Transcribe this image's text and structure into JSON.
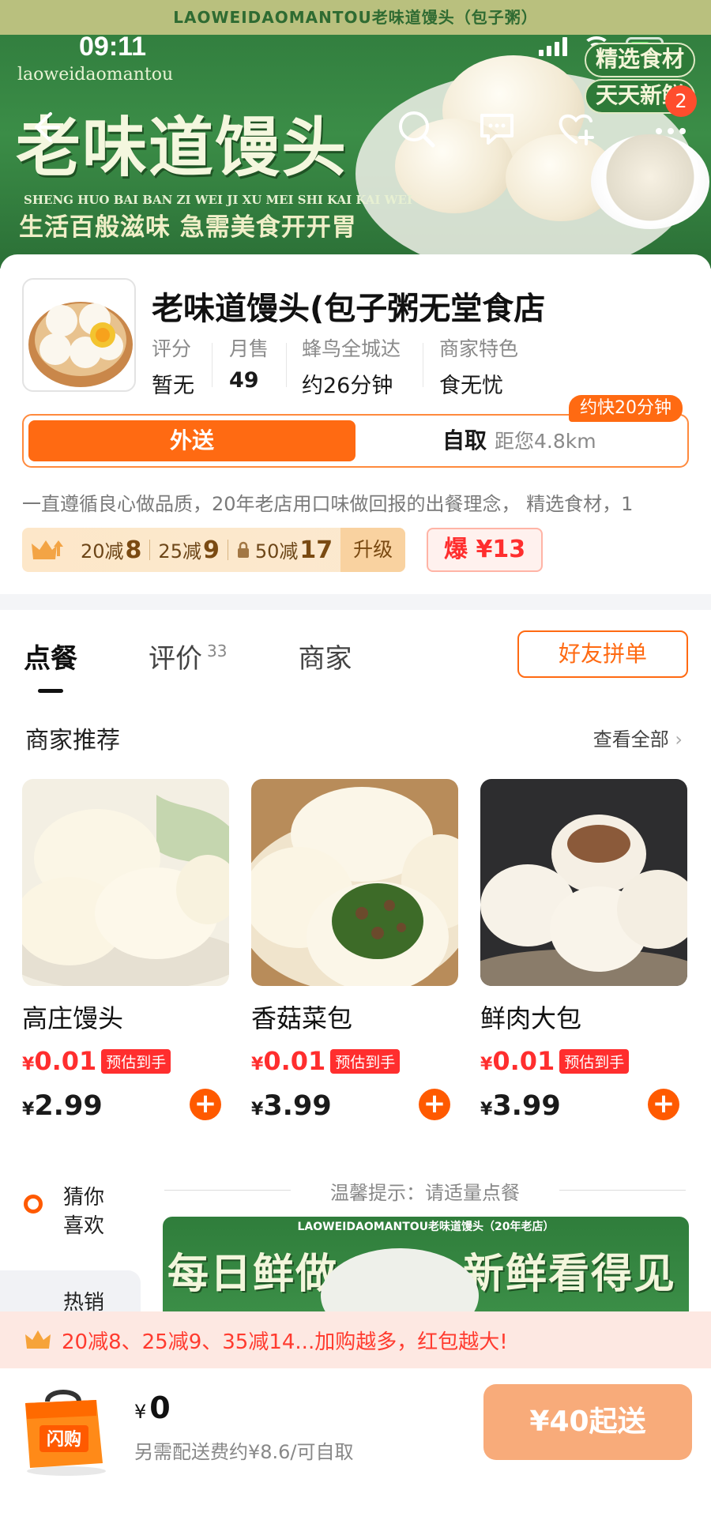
{
  "banner": {
    "strip_text": "LAOWEIDAOMANTOU老味道馒头（包子粥）",
    "time": "09:11",
    "brand_en": "laoweidaomantou",
    "brand_cn": "老味道馒头",
    "slogan_en": "SHENG HUO BAI BAN ZI WEI JI XU MEI SHI KAI KAI WEI",
    "slogan_cn": "生活百般滋味 急需美食开开胃",
    "badge_1": "精选食材",
    "badge_2": "天天新鲜",
    "notif_count": "2"
  },
  "shop": {
    "name": "老味道馒头(包子粥无堂食店",
    "stats": [
      {
        "label": "评分",
        "value": "暂无"
      },
      {
        "label": "月售",
        "value": "49"
      },
      {
        "label": "蜂鸟全城达",
        "value": "约26分钟"
      },
      {
        "label": "商家特色",
        "value": "食无忧"
      }
    ],
    "fast_tag": "约快20分钟",
    "delivery_label": "外送",
    "pickup_label": "自取",
    "distance": "距您4.8km",
    "description": "一直遵循良心做品质，20年老店用口味做回报的出餐理念， 精选食材，1",
    "promos": [
      {
        "text": "20减",
        "num": "8"
      },
      {
        "text": "25减",
        "num": "9"
      },
      {
        "text": "50减",
        "num": "17"
      }
    ],
    "upgrade": "升级",
    "hot": "爆 ¥13"
  },
  "tabs": [
    {
      "label": "点餐",
      "count": ""
    },
    {
      "label": "评价",
      "count": "33"
    },
    {
      "label": "商家",
      "count": ""
    }
  ],
  "group_button": "好友拼单",
  "recommend": {
    "title": "商家推荐",
    "see_all": "查看全部",
    "products": [
      {
        "name": "高庄馒头",
        "promo_price": "0.01",
        "promo_tag": "预估到手",
        "price": "2.99"
      },
      {
        "name": "香菇菜包",
        "promo_price": "0.01",
        "promo_tag": "预估到手",
        "price": "3.99"
      },
      {
        "name": "鲜肉大包",
        "promo_price": "0.01",
        "promo_tag": "预估到手",
        "price": "3.99"
      }
    ]
  },
  "sidebar": {
    "guess": "猜你\n喜欢",
    "next": "热销"
  },
  "tip": "温馨提示：请适量点餐",
  "menu_banner": {
    "top": "LAOWEIDAOMANTOU老味道馒头（20年老店）",
    "left": "每日鲜做",
    "right": "新鲜看得见"
  },
  "coupon_bar": "20减8、25减9、35减14...加购越多，红包越大!",
  "cart": {
    "currency": "¥",
    "amount": "0",
    "sub": "另需配送费约¥8.6/可自取",
    "go": "¥40起送",
    "bag_label": "闪购"
  }
}
